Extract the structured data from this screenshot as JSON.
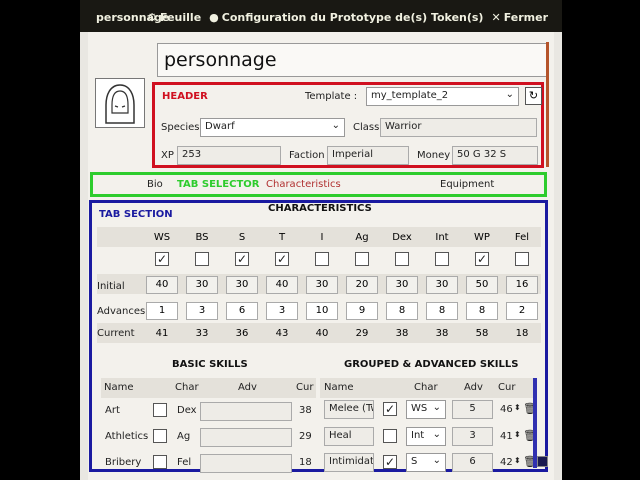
{
  "titlebar": {
    "title": "personnage",
    "sheet_label": "Feuille",
    "config_label": "Configuration du Prototype de(s) Token(s)",
    "close_label": "Fermer"
  },
  "name_value": "personnage",
  "annotations": {
    "header": "HEADER",
    "tab_selector": "TAB SELECTOR",
    "tab_section": "TAB SECTION"
  },
  "header": {
    "template_label": "Template :",
    "template_value": "my_template_2",
    "species_label": "Species",
    "species_value": "Dwarf",
    "class_label": "Class",
    "class_value": "Warrior",
    "xp_label": "XP",
    "xp_value": "253",
    "faction_label": "Faction",
    "faction_value": "Imperial",
    "money_label": "Money",
    "money_value": "50 G 32 S"
  },
  "tabs": {
    "bio": "Bio",
    "characteristics": "Characteristics",
    "equipment": "Equipment"
  },
  "characteristics": {
    "title": "CHARACTERISTICS",
    "headers": [
      "WS",
      "BS",
      "S",
      "T",
      "I",
      "Ag",
      "Dex",
      "Int",
      "WP",
      "Fel"
    ],
    "checked": [
      true,
      false,
      true,
      true,
      false,
      false,
      false,
      false,
      true,
      false
    ],
    "initial_label": "Initial",
    "initial": [
      "40",
      "30",
      "30",
      "40",
      "30",
      "20",
      "30",
      "30",
      "50",
      "16"
    ],
    "advances_label": "Advances",
    "advances": [
      "1",
      "3",
      "6",
      "3",
      "10",
      "9",
      "8",
      "8",
      "8",
      "2"
    ],
    "current_label": "Current",
    "current": [
      "41",
      "33",
      "36",
      "43",
      "40",
      "29",
      "38",
      "38",
      "58",
      "18"
    ]
  },
  "basic_skills": {
    "title": "BASIC SKILLS",
    "col_name": "Name",
    "col_char": "Char",
    "col_adv": "Adv",
    "col_cur": "Cur",
    "rows": [
      {
        "name": "Art",
        "char": "Dex",
        "cur": "38"
      },
      {
        "name": "Athletics",
        "char": "Ag",
        "cur": "29"
      },
      {
        "name": "Bribery",
        "char": "Fel",
        "cur": "18"
      }
    ]
  },
  "grouped_skills": {
    "title": "GROUPED & ADVANCED SKILLS",
    "col_name": "Name",
    "col_char": "Char",
    "col_adv": "Adv",
    "col_cur": "Cur",
    "rows": [
      {
        "name": "Melee (Tw",
        "checked": true,
        "char": "WS",
        "adv": "5",
        "cur": "46"
      },
      {
        "name": "Heal",
        "checked": false,
        "char": "Int",
        "adv": "3",
        "cur": "41"
      },
      {
        "name": "Intimidat",
        "checked": true,
        "char": "S",
        "adv": "6",
        "cur": "42"
      }
    ]
  }
}
